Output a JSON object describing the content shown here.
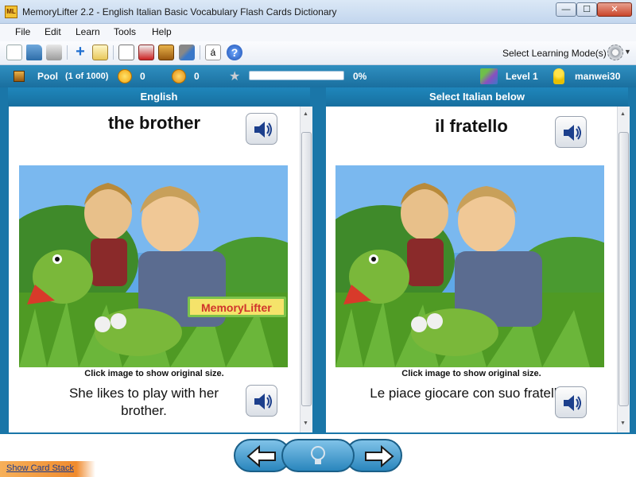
{
  "window": {
    "title": "MemoryLifter 2.2 - English Italian Basic Vocabulary Flash Cards Dictionary",
    "app_icon_text": "ML",
    "minimize": "—",
    "maximize": "☐",
    "close": "✕"
  },
  "menu": {
    "items": [
      "File",
      "Edit",
      "Learn",
      "Tools",
      "Help"
    ]
  },
  "toolbar": {
    "icons": [
      "new-document-icon",
      "open-folder-icon",
      "print-icon",
      "add-icon",
      "edit-icon",
      "presentation-icon",
      "statistics-icon",
      "card-stack-icon",
      "settings-tools-icon",
      "special-chars-icon",
      "help-icon"
    ],
    "special_char_glyph": "á",
    "help_glyph": "?",
    "learning_mode_label": "Select Learning Mode(s)"
  },
  "status": {
    "pool_label": "Pool",
    "pool_count": "(1 of 1000)",
    "correct_count": "0",
    "wrong_count": "0",
    "progress_percent": "0%",
    "progress_value": 0,
    "level": "Level 1",
    "user": "manwei30"
  },
  "question": {
    "header": "English",
    "word": "the brother",
    "image_caption": "Click image to show original size.",
    "example_sentence": "She likes to play with her brother."
  },
  "answer": {
    "header": "Select Italian below",
    "word": "il fratello",
    "image_caption": "Click image to show original size.",
    "example_sentence": "Le piace giocare con suo fratello."
  },
  "watermark_text": "MemoryLifter",
  "footer": {
    "show_card_stack": "Show Card Stack"
  },
  "colors": {
    "frame_blue": "#1a76a8",
    "status_blue": "#2f8fc0",
    "accent_orange": "#f08b2e"
  }
}
